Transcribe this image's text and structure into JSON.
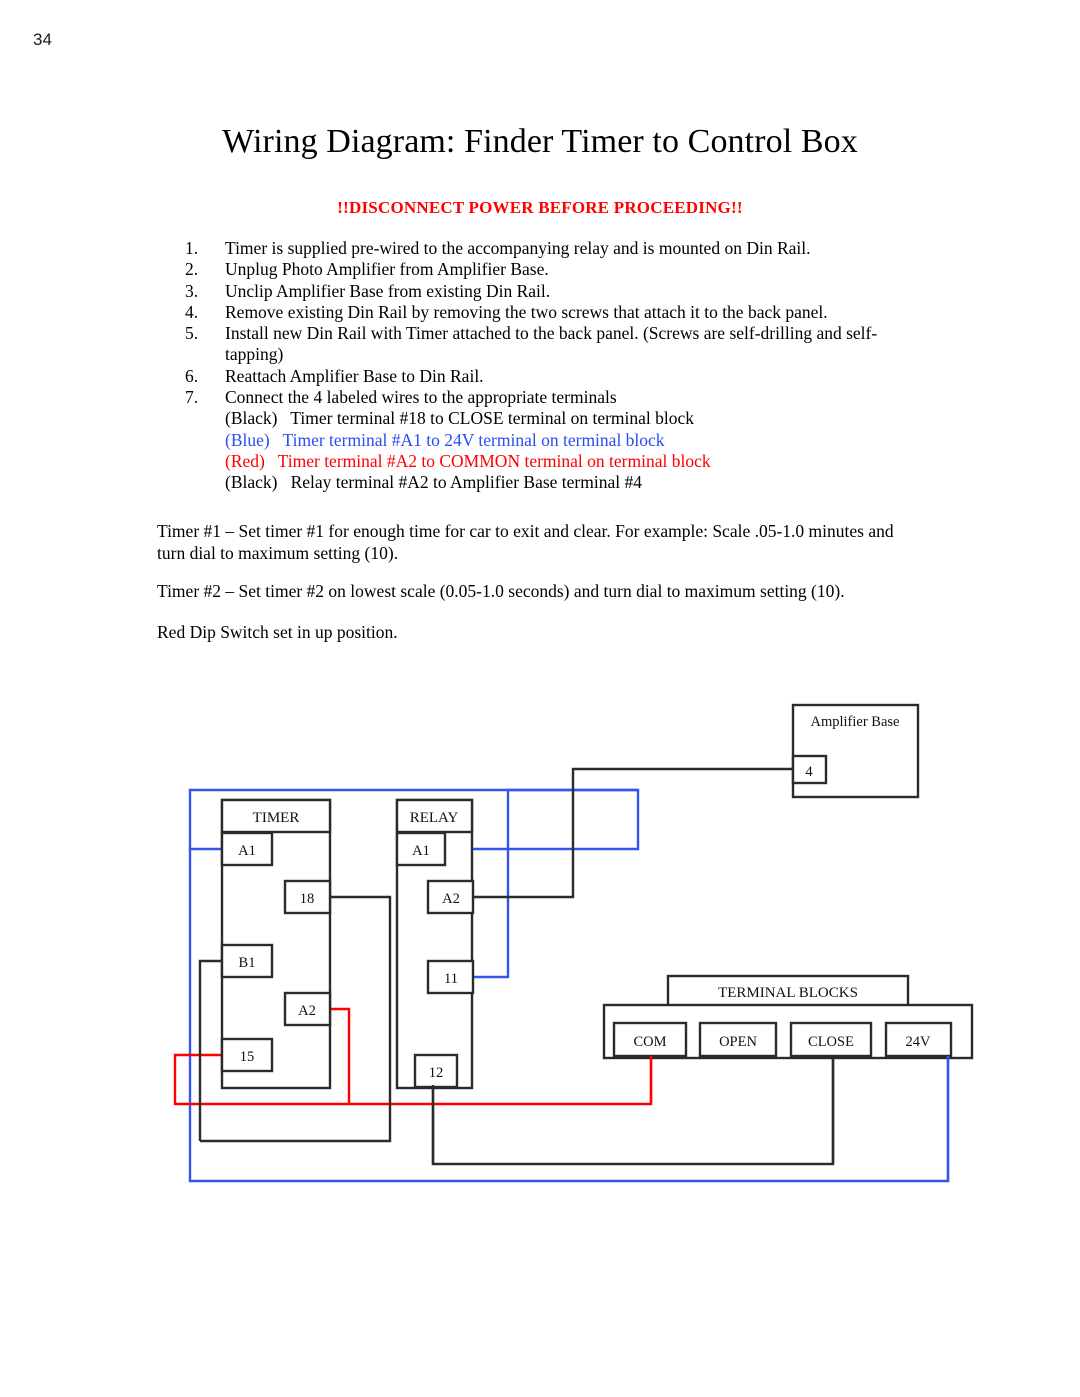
{
  "page": {
    "number": "34"
  },
  "header": {
    "title": "Wiring Diagram: Finder Timer to Control Box",
    "warning": "!!DISCONNECT POWER BEFORE PROCEEDING!!"
  },
  "steps": [
    {
      "num": "1.",
      "text": "Timer is supplied pre-wired to the accompanying relay and is mounted on Din Rail."
    },
    {
      "num": "2.",
      "text": "Unplug Photo Amplifier from Amplifier Base."
    },
    {
      "num": "3.",
      "text": "Unclip Amplifier Base from existing Din Rail."
    },
    {
      "num": "4.",
      "text": "Remove existing Din Rail by removing the two screws that attach it to the back panel."
    },
    {
      "num": "5.",
      "text": "Install new Din Rail with Timer attached to the back panel. (Screws are self-drilling and self-tapping)"
    },
    {
      "num": "6.",
      "text": "Reattach Amplifier Base to Din Rail."
    },
    {
      "num": "7.",
      "text": "Connect the 4 labeled wires to the appropriate terminals"
    }
  ],
  "wire_list": [
    {
      "color_name": "(Black)",
      "color": "#000000",
      "text": "Timer terminal #18 to CLOSE terminal on terminal block"
    },
    {
      "color_name": "(Blue)",
      "color": "#2b4cf0",
      "text": "Timer terminal #A1 to 24V terminal on terminal block"
    },
    {
      "color_name": "(Red)",
      "color": "#ff0000",
      "text": "Timer terminal #A2 to COMMON terminal on terminal block"
    },
    {
      "color_name": "(Black)",
      "color": "#000000",
      "text": "Relay terminal #A2 to Amplifier Base terminal #4"
    }
  ],
  "paragraphs": {
    "timer1": "Timer #1 – Set timer #1 for enough time for car to exit and clear. For example: Scale .05-1.0 minutes and turn dial to maximum setting (10).",
    "timer2": "Timer #2 – Set timer #2 on lowest scale (0.05-1.0 seconds) and turn dial to maximum setting (10).",
    "dip": "Red Dip Switch set in up position."
  },
  "diagram": {
    "timer": {
      "title": "TIMER",
      "terminals": [
        {
          "label": "A1"
        },
        {
          "label": "18"
        },
        {
          "label": "B1"
        },
        {
          "label": "A2"
        },
        {
          "label": "15"
        }
      ]
    },
    "relay": {
      "title": "RELAY",
      "terminals": [
        {
          "label": "A1"
        },
        {
          "label": "A2"
        },
        {
          "label": "11"
        },
        {
          "label": "12"
        }
      ]
    },
    "amplifier_base": {
      "title": "Amplifier Base",
      "terminals": [
        {
          "label": "4"
        }
      ]
    },
    "terminal_blocks": {
      "title": "TERMINAL BLOCKS",
      "terminals": [
        {
          "label": "COM"
        },
        {
          "label": "OPEN"
        },
        {
          "label": "CLOSE"
        },
        {
          "label": "24V"
        }
      ]
    },
    "wire_colors": {
      "black": "#1a1a1a",
      "blue": "#3355ee",
      "red": "#ff0000"
    }
  }
}
